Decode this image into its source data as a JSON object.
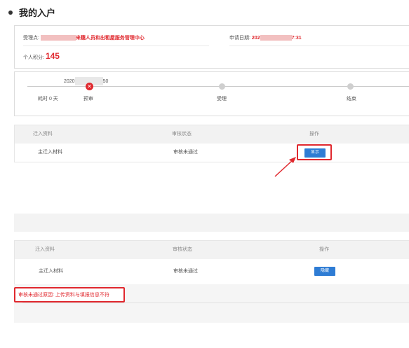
{
  "section_title": "我的入户",
  "info": {
    "accept_label": "受理点:",
    "accept_value_suffix": "来穗人员和出租屋服务管理中心",
    "apply_date_label": "申请日期:",
    "apply_date_prefix": "202",
    "apply_date_suffix": "7:31",
    "score_label": "个人积分:",
    "score_value": "145"
  },
  "timeline": {
    "date_prefix": "2020",
    "date_suffix": "50",
    "elapsed_label": "耗时 0 天",
    "steps": [
      "预审",
      "受理",
      "结束"
    ]
  },
  "table_top": {
    "headers": [
      "迁入资料",
      "审核状态",
      "操作"
    ],
    "row": {
      "name": "主迁入材料",
      "status": "审核未通过",
      "action": "显示"
    }
  },
  "table_bottom": {
    "headers": [
      "迁入资料",
      "审核状态",
      "操作"
    ],
    "row": {
      "name": "主迁入材料",
      "status": "审核未通过",
      "action": "隐藏"
    }
  },
  "reject_reason": "审核未通过原因: 上传资料与填报信息不符",
  "colors": {
    "accent_red": "#e0282e",
    "button_blue": "#2e7cd4"
  }
}
